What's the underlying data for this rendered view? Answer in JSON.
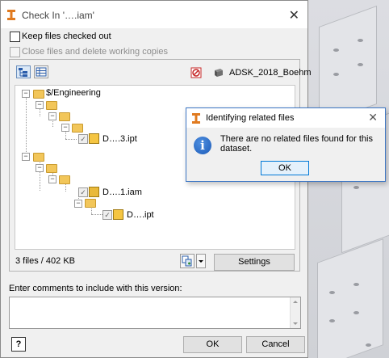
{
  "window": {
    "title": "Check In '….iam'",
    "close_glyph": "✕"
  },
  "options": {
    "keep_checked_out": "Keep files checked out",
    "close_and_delete": "Close files and delete working copies"
  },
  "toolbar": {
    "vault_user": "ADSK_2018_Boehm"
  },
  "tree": {
    "root_label": "$/Engineering",
    "nodes": [
      {
        "label": "D….3.ipt",
        "type": "part"
      },
      {
        "label": "D….1.iam",
        "type": "assembly"
      },
      {
        "label": "D….ipt",
        "type": "part"
      }
    ]
  },
  "status": {
    "file_count": "3 files / 402 KB"
  },
  "buttons": {
    "settings": "Settings",
    "ok": "OK",
    "cancel": "Cancel",
    "help_glyph": "?"
  },
  "comments": {
    "label": "Enter comments to include with this version:",
    "value": ""
  },
  "dialog": {
    "title": "Identifying related files",
    "message_line1": "There are no related files found for this",
    "message_line2": "dataset.",
    "ok": "OK",
    "close_glyph": "✕",
    "icon_glyph": "i"
  },
  "colors": {
    "accent": "#3c76c4",
    "folder": "#f2c65a",
    "part": "#f5c542"
  }
}
